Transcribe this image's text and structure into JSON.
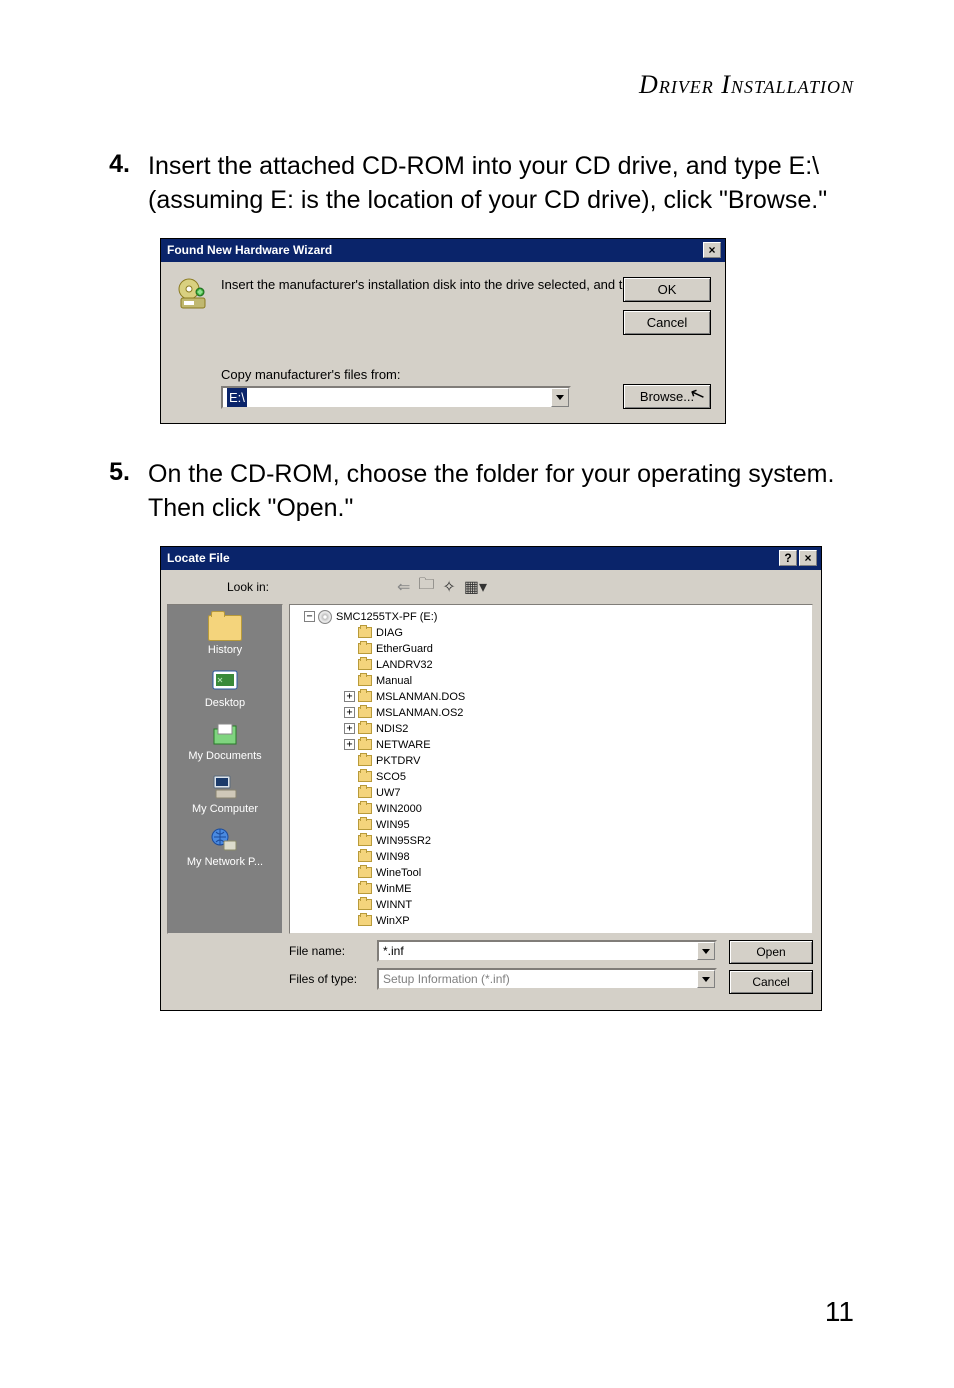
{
  "header": {
    "title": "Driver Installation"
  },
  "steps": [
    {
      "num": "4.",
      "text": "Insert the attached CD-ROM into your CD drive, and type E:\\ (assuming E: is the location of your CD drive), click \"Browse.\""
    },
    {
      "num": "5.",
      "text": "On the CD-ROM, choose the folder for your operating system. Then click \"Open.\""
    }
  ],
  "page_number": "11",
  "dialog1": {
    "title": "Found New Hardware Wizard",
    "close_glyph": "×",
    "instruction": "Insert the manufacturer's installation disk into the drive selected, and then click OK.",
    "copy_label": "Copy manufacturer's files from:",
    "path_value": "E:\\",
    "ok_label": "OK",
    "cancel_label": "Cancel",
    "browse_label": "Browse..."
  },
  "dialog2": {
    "title": "Locate File",
    "help_glyph": "?",
    "close_glyph": "×",
    "lookin_label": "Look in:",
    "toolbar_icons": {
      "back": "⇐",
      "up": "🗀",
      "new": "✧",
      "view": "▦▾"
    },
    "places": [
      {
        "label": "History",
        "icon": "folder"
      },
      {
        "label": "Desktop",
        "icon": "desktop"
      },
      {
        "label": "My Documents",
        "icon": "mydocs"
      },
      {
        "label": "My Computer",
        "icon": "computer"
      },
      {
        "label": "My Network P...",
        "icon": "network"
      }
    ],
    "root": {
      "label": "SMC1255TX-PF (E:)",
      "exp": "−"
    },
    "folders": [
      {
        "label": "DIAG",
        "exp": null
      },
      {
        "label": "EtherGuard",
        "exp": null
      },
      {
        "label": "LANDRV32",
        "exp": null
      },
      {
        "label": "Manual",
        "exp": null
      },
      {
        "label": "MSLANMAN.DOS",
        "exp": "+"
      },
      {
        "label": "MSLANMAN.OS2",
        "exp": "+"
      },
      {
        "label": "NDIS2",
        "exp": "+"
      },
      {
        "label": "NETWARE",
        "exp": "+"
      },
      {
        "label": "PKTDRV",
        "exp": null
      },
      {
        "label": "SCO5",
        "exp": null
      },
      {
        "label": "UW7",
        "exp": null
      },
      {
        "label": "WIN2000",
        "exp": null
      },
      {
        "label": "WIN95",
        "exp": null
      },
      {
        "label": "WIN95SR2",
        "exp": null
      },
      {
        "label": "WIN98",
        "exp": null
      },
      {
        "label": "WineTool",
        "exp": null
      },
      {
        "label": "WinME",
        "exp": null
      },
      {
        "label": "WINNT",
        "exp": null
      },
      {
        "label": "WinXP",
        "exp": null
      }
    ],
    "filename_label": "File name:",
    "filename_value": "*.inf",
    "filetype_label": "Files of type:",
    "filetype_value": "Setup Information (*.inf)",
    "open_label": "Open",
    "cancel_label": "Cancel"
  }
}
